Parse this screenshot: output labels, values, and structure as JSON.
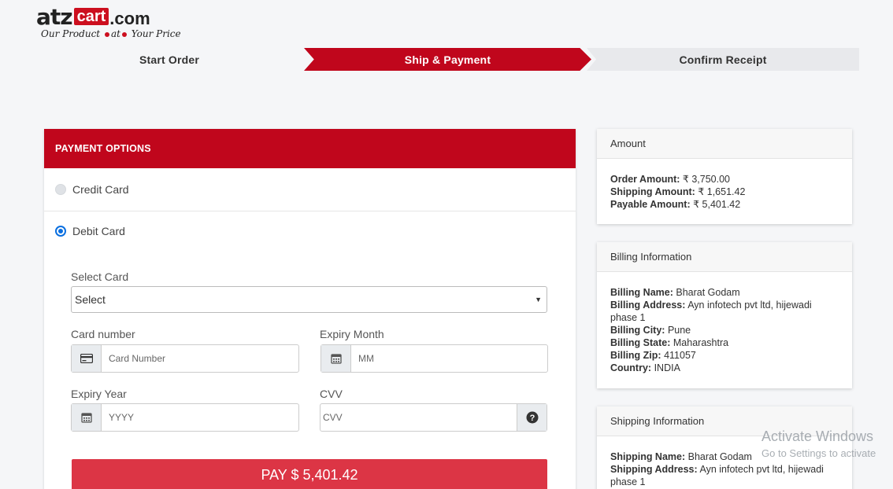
{
  "logo": {
    "part1": "atz",
    "part2": "cart",
    "part3": ".com",
    "tagline_a": "Our Product",
    "tagline_b": "at",
    "tagline_c": "Your Price"
  },
  "steps": [
    "Start Order",
    "Ship & Payment",
    "Confirm Receipt"
  ],
  "payment": {
    "title": "PAYMENT OPTIONS",
    "credit_label": "Credit Card",
    "debit_label": "Debit Card",
    "select_card_label": "Select Card",
    "select_value": "Select",
    "card_number_label": "Card number",
    "card_number_placeholder": "Card Number",
    "expiry_month_label": "Expiry Month",
    "expiry_month_placeholder": "MM",
    "expiry_year_label": "Expiry Year",
    "expiry_year_placeholder": "YYYY",
    "cvv_label": "CVV",
    "cvv_placeholder": "CVV",
    "pay_button": "PAY $ 5,401.42"
  },
  "amount": {
    "title": "Amount",
    "order_label": "Order Amount:",
    "order_value": "₹ 3,750.00",
    "shipping_label": "Shipping Amount:",
    "shipping_value": "₹ 1,651.42",
    "payable_label": "Payable Amount:",
    "payable_value": "₹ 5,401.42"
  },
  "billing": {
    "title": "Billing Information",
    "name_label": "Billing Name:",
    "name_value": "Bharat Godam",
    "address_label": "Billing Address:",
    "address_value": "Ayn infotech pvt ltd, hijewadi phase 1",
    "city_label": "Billing City:",
    "city_value": "Pune",
    "state_label": "Billing State:",
    "state_value": "Maharashtra",
    "zip_label": "Billing Zip:",
    "zip_value": "411057",
    "country_label": "Country:",
    "country_value": "INDIA"
  },
  "shipping": {
    "title": "Shipping Information",
    "name_label": "Shipping Name:",
    "name_value": "Bharat Godam",
    "address_label": "Shipping Address:",
    "address_value": "Ayn infotech pvt ltd, hijewadi phase 1"
  },
  "watermark": {
    "line1": "Activate Windows",
    "line2": "Go to Settings to activate"
  },
  "colors": {
    "brand_red": "#c0061c",
    "pay_red": "#dc3545",
    "radio_blue": "#0a6fe0"
  }
}
